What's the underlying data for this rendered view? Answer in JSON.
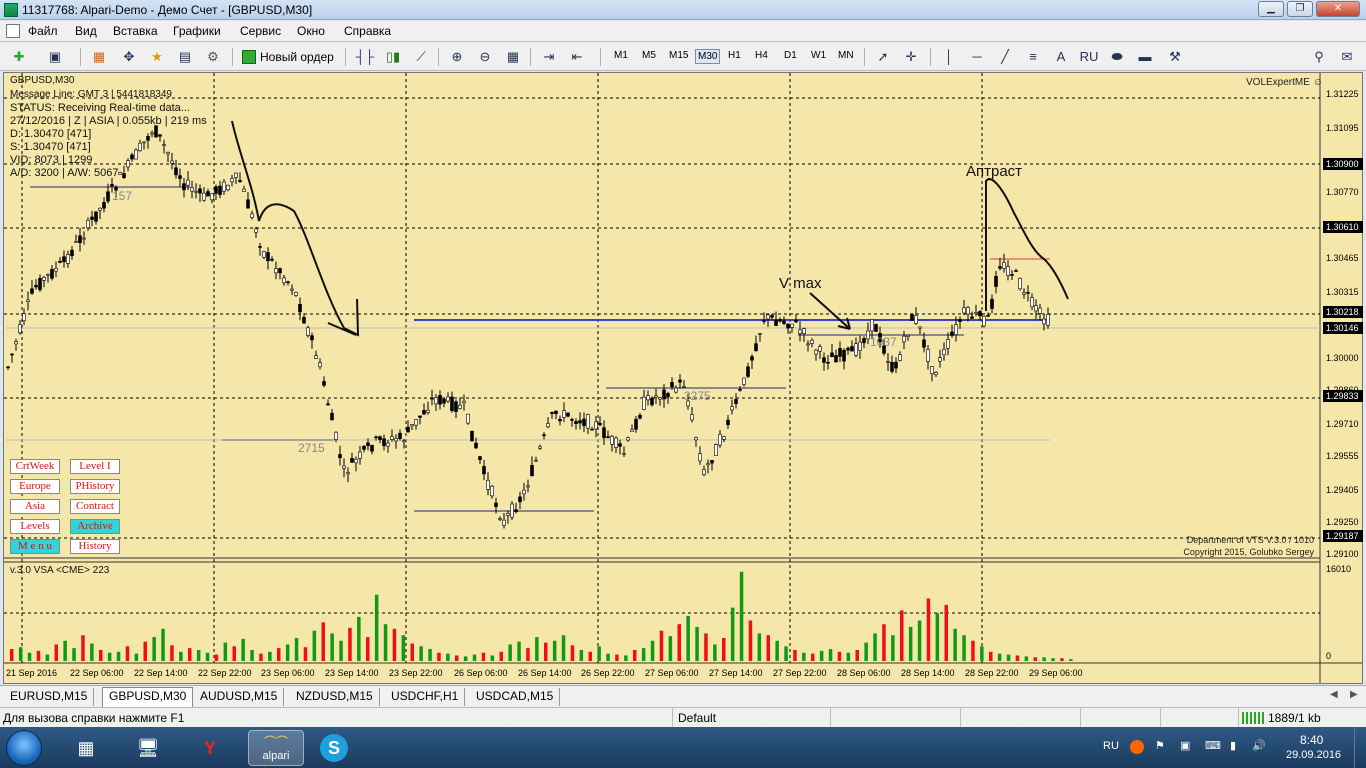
{
  "window": {
    "title": "11317768: Alpari-Demo - Демо Счет - [GBPUSD,M30]",
    "minimize": "▁",
    "restore": "❐",
    "close": "✕"
  },
  "menu": [
    "Файл",
    "Вид",
    "Вставка",
    "Графики",
    "Сервис",
    "Окно",
    "Справка"
  ],
  "toolbar": {
    "new_order": "Новый ордер",
    "timeframes": [
      "M1",
      "M5",
      "M15",
      "M30",
      "H1",
      "H4",
      "D1",
      "W1",
      "MN"
    ],
    "active_timeframe": "M30",
    "text_tool": "A",
    "language_btn": "RU"
  },
  "chart": {
    "symbol_header": "GBPUSD,M30",
    "info_lines": [
      "Message Line: GMT 3 | 5441818349",
      "STATUS:  Receiving Real-time data...",
      "27/12/2016 | Z | ASIA | 0.055kb | 219 ms",
      "D: 1.30470  [471]",
      "S: 1.30470  [471]",
      "VID: 8073 | 1299",
      "A/D: 3200 | A/W: 5067"
    ],
    "expert_name": "VOLExpertME ☺",
    "level_labels": [
      "2715",
      "3275",
      "1037",
      "157"
    ],
    "annotations": {
      "upthrust": "Аптраст",
      "vmax": "V max"
    },
    "copyright_1": "Department of VTS  V.3.0 / 1010",
    "copyright_2": "Copyright 2015, Golubko Sergey",
    "indicator_title": "v.3.0 VSA <CME> 223",
    "indicator_max": "16010",
    "indicator_zero": "0",
    "buttons": [
      {
        "label": "CrtWeek",
        "cyan": false
      },
      {
        "label": "Level I",
        "cyan": false
      },
      {
        "label": "Europe",
        "cyan": false
      },
      {
        "label": "PHistory",
        "cyan": false
      },
      {
        "label": "Asia",
        "cyan": false
      },
      {
        "label": "Contract",
        "cyan": false
      },
      {
        "label": "Levels",
        "cyan": false
      },
      {
        "label": "Archive",
        "cyan": true
      },
      {
        "label": "M e n u",
        "cyan": true
      },
      {
        "label": "History",
        "cyan": false
      }
    ],
    "price_axis": [
      "1.31225",
      "1.31095",
      "1.30770",
      "1.30465",
      "1.30315",
      "1.30000",
      "1.29860",
      "1.29710",
      "1.29555",
      "1.29405",
      "1.29250",
      "1.29100"
    ],
    "price_highlights": [
      "1.30900",
      "1.30610",
      "1.30218",
      "1.30146",
      "1.29833",
      "1.29187"
    ],
    "time_axis": [
      "21 Sep 2016",
      "22 Sep 06:00",
      "22 Sep 14:00",
      "22 Sep 22:00",
      "23 Sep 06:00",
      "23 Sep 14:00",
      "23 Sep 22:00",
      "26 Sep 06:00",
      "26 Sep 14:00",
      "26 Sep 22:00",
      "27 Sep 06:00",
      "27 Sep 14:00",
      "27 Sep 22:00",
      "28 Sep 06:00",
      "28 Sep 14:00",
      "28 Sep 22:00",
      "29 Sep 06:00"
    ],
    "colors": {
      "background": "#f5e7a9",
      "candles": "#000000",
      "volume_up": "#119911",
      "volume_down": "#ee1111",
      "level_line": "#999999",
      "blue_line": "#3344cc"
    }
  },
  "chart_data": {
    "type": "bar",
    "series": [
      {
        "values": [
          0.13,
          0.15,
          0.09,
          0.11,
          0.07,
          0.18,
          0.22,
          0.14,
          0.28,
          0.19,
          0.12,
          0.09,
          0.1,
          0.16,
          0.08,
          0.21,
          0.26,
          0.35,
          0.17,
          0.1,
          0.14,
          0.12,
          0.09,
          0.07,
          0.2,
          0.16,
          0.24,
          0.12,
          0.08,
          0.1,
          0.14,
          0.18,
          0.25,
          0.15,
          0.33,
          0.42,
          0.3,
          0.22,
          0.36,
          0.48,
          0.26,
          0.72,
          0.4,
          0.35,
          0.28,
          0.19,
          0.16,
          0.13,
          0.09,
          0.08,
          0.06,
          0.05,
          0.07,
          0.09,
          0.06,
          0.1,
          0.18,
          0.21,
          0.14,
          0.26,
          0.2,
          0.22,
          0.28,
          0.17,
          0.12,
          0.1,
          0.16,
          0.08,
          0.07,
          0.06,
          0.12,
          0.14,
          0.22,
          0.33,
          0.27,
          0.4,
          0.49,
          0.37,
          0.3,
          0.18,
          0.25,
          0.58,
          0.97,
          0.44,
          0.3,
          0.28,
          0.22,
          0.16,
          0.12,
          0.09,
          0.08,
          0.11,
          0.13,
          0.1,
          0.09,
          0.12,
          0.2,
          0.3,
          0.4,
          0.28,
          0.55,
          0.37,
          0.44,
          0.68,
          0.52,
          0.61,
          0.35,
          0.28,
          0.22,
          0.16,
          0.1,
          0.08,
          0.07,
          0.06,
          0.05,
          0.04,
          0.04,
          0.03,
          0.03,
          0.02
        ]
      }
    ]
  },
  "tabs": [
    "EURUSD,M15",
    "GBPUSD,M30",
    "AUDUSD,M15",
    "NZDUSD,M15",
    "USDCHF,H1",
    "USDCAD,M15"
  ],
  "active_tab": "GBPUSD,M30",
  "status": {
    "help": "Для вызова справки нажмите F1",
    "profile": "Default",
    "traffic": "1889/1 kb"
  },
  "taskbar": {
    "app_label": "alpari",
    "language": "RU",
    "time": "8:40",
    "date": "29.09.2016"
  }
}
